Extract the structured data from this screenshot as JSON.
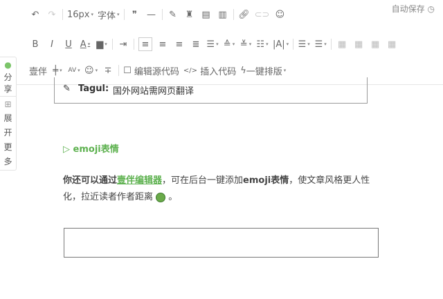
{
  "autosave": "自动保存",
  "toolbar1": {
    "font_size": "16px",
    "font": "字体"
  },
  "toolbar3": {
    "yiban": "壹伴",
    "edit_source": "编辑源代码",
    "insert_code": "插入代码",
    "one_click": "一键排版"
  },
  "side": {
    "share": "分享",
    "expand": [
      "展",
      "开",
      "更",
      "多"
    ]
  },
  "content": {
    "tag_label": "Tagul:",
    "tag_text": "国外网站需网页翻译",
    "heading": "▷ emoji表情",
    "p1": "你还可以通过",
    "link": "壹伴编辑器",
    "p2": "，可在后台一键添加",
    "p3": "emoji表情",
    "p4": "，使文章风格更人性化，拉近读者作者距离",
    "p5": " 。"
  }
}
